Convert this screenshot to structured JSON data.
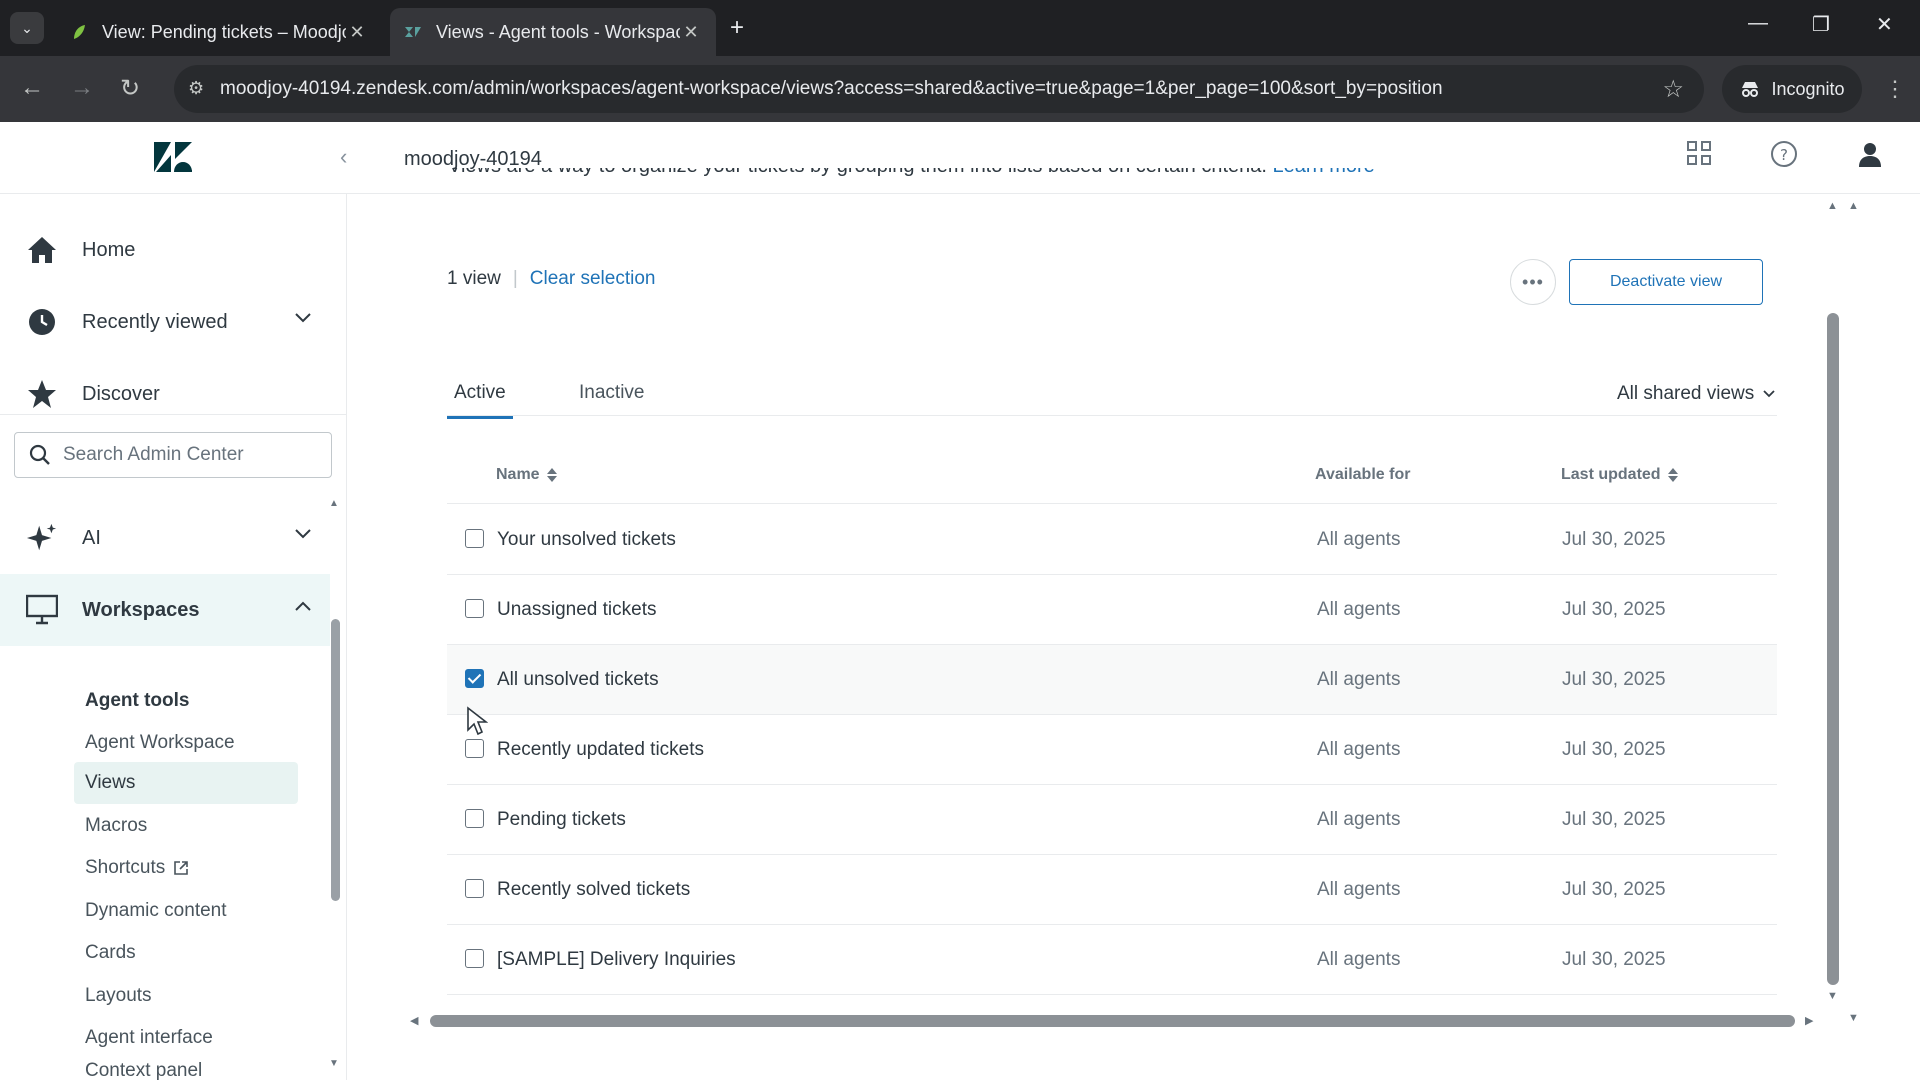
{
  "browser": {
    "tabs": [
      {
        "title": "View: Pending tickets – Moodjoy",
        "active": false
      },
      {
        "title": "Views - Agent tools - Workspaces",
        "active": true
      }
    ],
    "url": "moodjoy-40194.zendesk.com/admin/workspaces/agent-workspace/views?access=shared&active=true&page=1&per_page=100&sort_by=position",
    "incognito_label": "Incognito"
  },
  "header": {
    "account": "moodjoy-40194"
  },
  "sidebar": {
    "nav": {
      "home": "Home",
      "recently_viewed": "Recently viewed",
      "discover": "Discover",
      "ai": "AI",
      "workspaces": "Workspaces"
    },
    "search_placeholder": "Search Admin Center",
    "section_title": "Agent tools",
    "sub_items": [
      {
        "label": "Agent Workspace"
      },
      {
        "label": "Views"
      },
      {
        "label": "Macros"
      },
      {
        "label": "Shortcuts"
      },
      {
        "label": "Dynamic content"
      },
      {
        "label": "Cards"
      },
      {
        "label": "Layouts"
      },
      {
        "label": "Agent interface"
      },
      {
        "label": "Context panel"
      }
    ]
  },
  "main": {
    "intro_text": "Views are a way to organize your tickets by grouping them into lists based on certain criteria.",
    "learn_more": "Learn more",
    "selection_count": "1 view",
    "clear_selection": "Clear selection",
    "deactivate_label": "Deactivate view",
    "tabs": {
      "active": "Active",
      "inactive": "Inactive"
    },
    "filter_label": "All shared views",
    "columns": {
      "name": "Name",
      "available_for": "Available for",
      "last_updated": "Last updated"
    },
    "rows": [
      {
        "name": "Your unsolved tickets",
        "available_for": "All agents",
        "last_updated": "Jul 30, 2025",
        "checked": false
      },
      {
        "name": "Unassigned tickets",
        "available_for": "All agents",
        "last_updated": "Jul 30, 2025",
        "checked": false
      },
      {
        "name": "All unsolved tickets",
        "available_for": "All agents",
        "last_updated": "Jul 30, 2025",
        "checked": true
      },
      {
        "name": "Recently updated tickets",
        "available_for": "All agents",
        "last_updated": "Jul 30, 2025",
        "checked": false
      },
      {
        "name": "Pending tickets",
        "available_for": "All agents",
        "last_updated": "Jul 30, 2025",
        "checked": false
      },
      {
        "name": "Recently solved tickets",
        "available_for": "All agents",
        "last_updated": "Jul 30, 2025",
        "checked": false
      },
      {
        "name": "[SAMPLE] Delivery Inquiries",
        "available_for": "All agents",
        "last_updated": "Jul 30, 2025",
        "checked": false
      }
    ]
  },
  "colors": {
    "accent": "#1f73b7",
    "selected_nav_bg": "#edf7f7",
    "text": "#2f3941",
    "muted": "#68737d"
  }
}
